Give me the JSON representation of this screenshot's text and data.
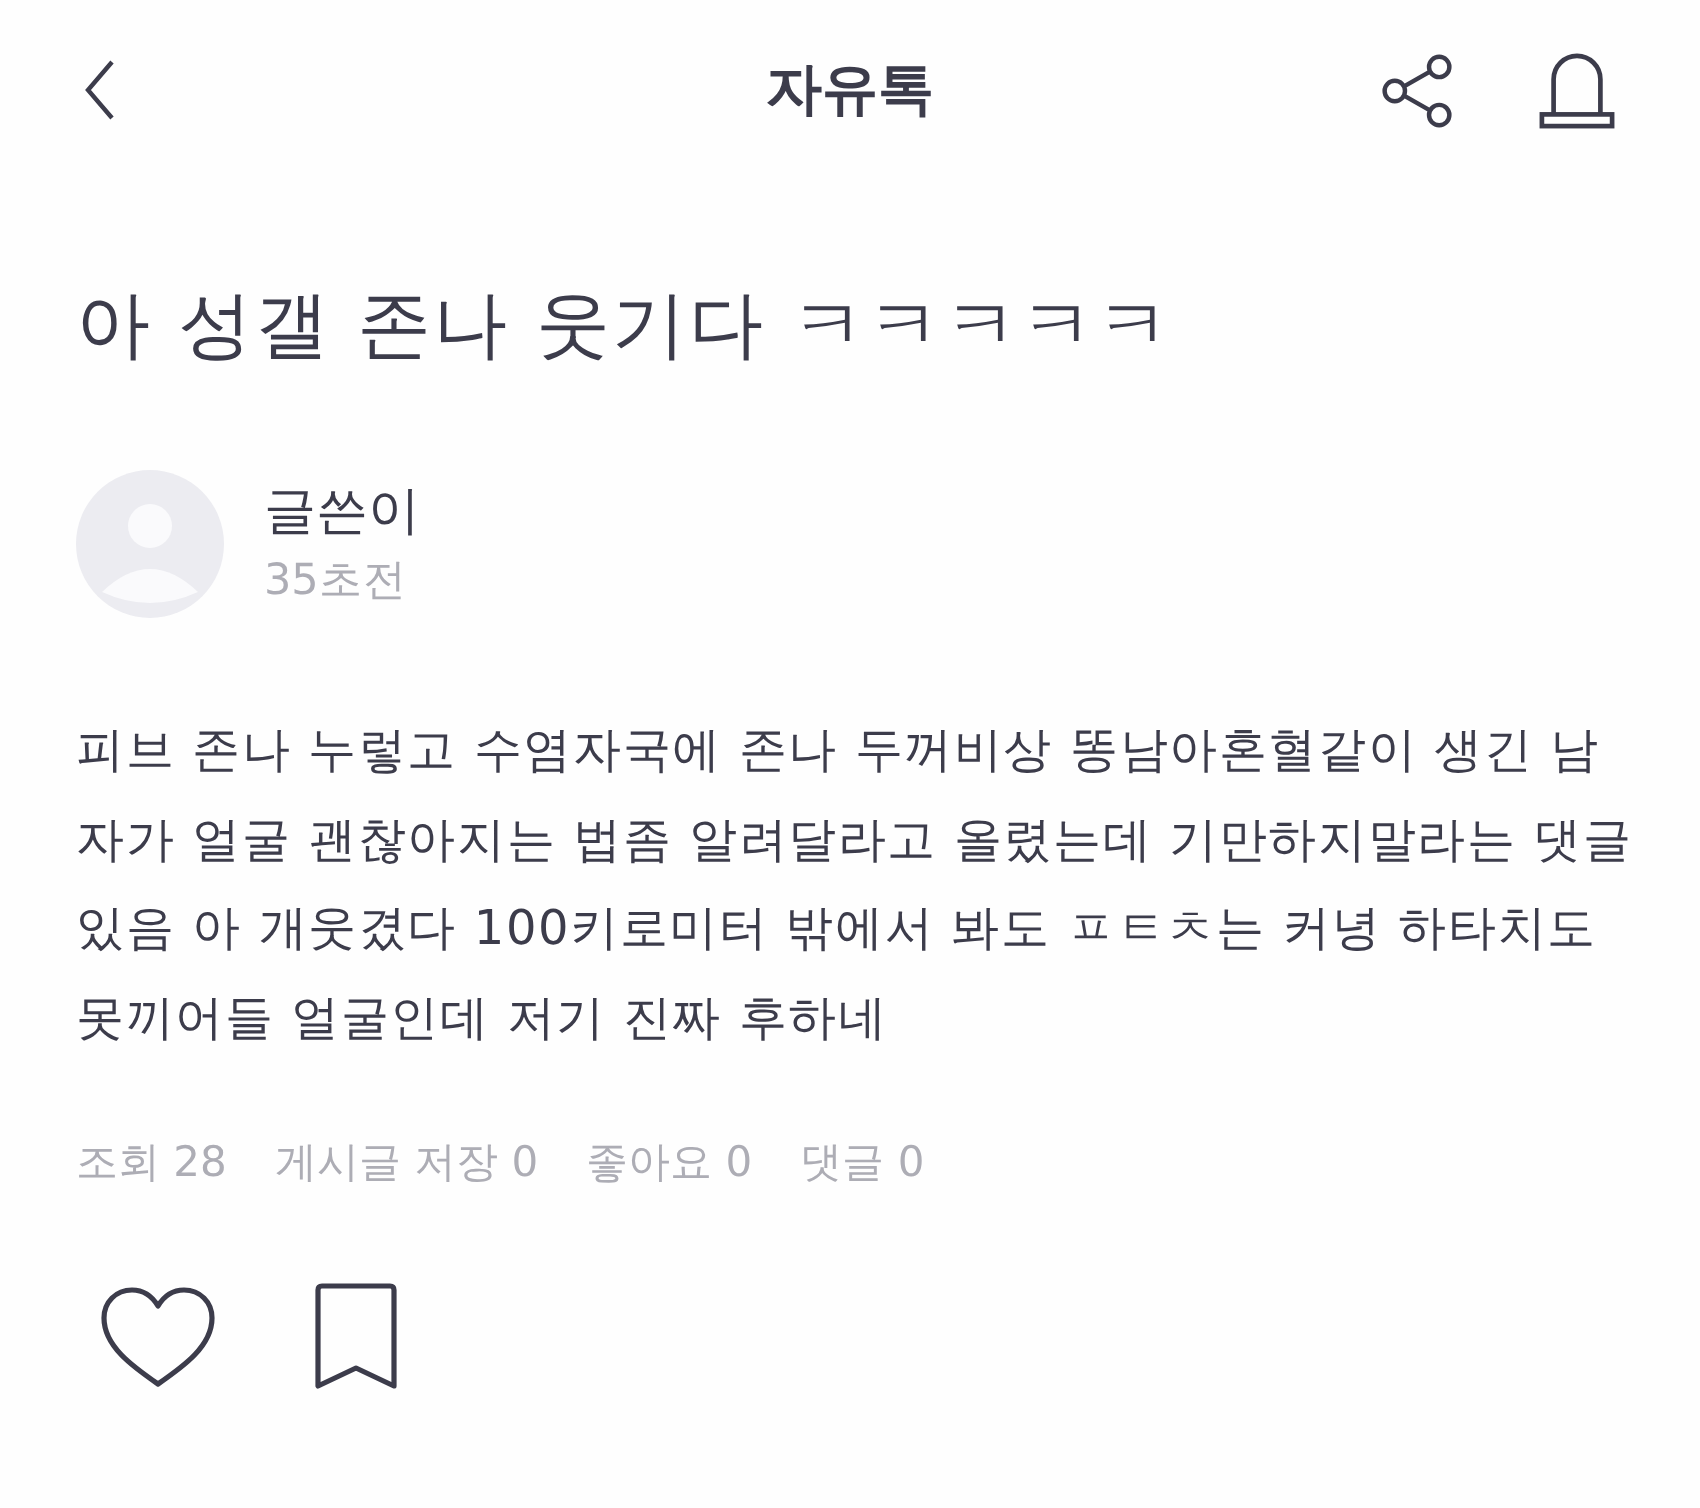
{
  "header": {
    "title": "자유톡"
  },
  "post": {
    "title": "아 성갤 존나 웃기다 ㅋㅋㅋㅋㅋ",
    "author": {
      "name": "글쓴이",
      "time": "35초전"
    },
    "body": "피브 존나 누렇고 수염자국에 존나 두꺼비상 똥남아혼혈같이 생긴 남자가 얼굴 괜찮아지는 법좀 알려달라고 올렸는데 기만하지말라는 댓글 있음 아 개웃겼다 100키로미터 밖에서 봐도 ㅍㅌㅊ는 커녕 하타치도 못끼어들 얼굴인데 저기 진짜 후하네",
    "stats": [
      "조회 28",
      "게시글 저장 0",
      "좋아요 0",
      "댓글 0"
    ]
  },
  "actions": [
    {
      "kind": "like",
      "on": false
    },
    {
      "kind": "bookmark",
      "on": false
    }
  ]
}
